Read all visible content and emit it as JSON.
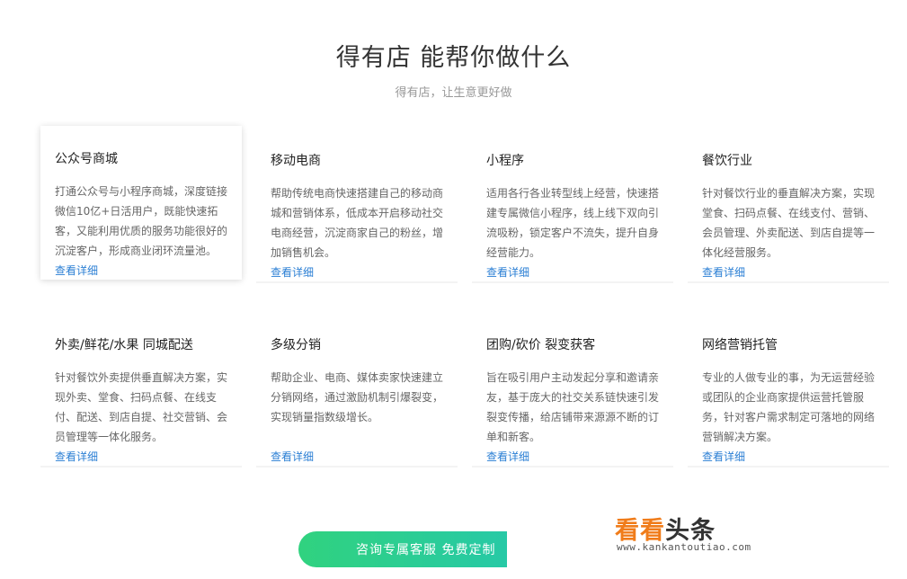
{
  "hero": {
    "title": "得有店 能帮你做什么",
    "subtitle": "得有店，让生意更好做"
  },
  "cards": [
    {
      "title": "公众号商城",
      "desc": "打通公众号与小程序商城，深度链接微信10亿+日活用户，既能快速拓客，又能利用优质的服务功能很好的沉淀客户，形成商业闭环流量池。",
      "link": "查看详细"
    },
    {
      "title": "移动电商",
      "desc": "帮助传统电商快速搭建自己的移动商城和营销体系，低成本开启移动社交电商经营，沉淀商家自己的粉丝，增加销售机会。",
      "link": "查看详细"
    },
    {
      "title": "小程序",
      "desc": "适用各行各业转型线上经营，快速搭建专属微信小程序，线上线下双向引流吸粉，锁定客户不流失，提升自身经营能力。",
      "link": "查看详细"
    },
    {
      "title": "餐饮行业",
      "desc": "针对餐饮行业的垂直解决方案，实现堂食、扫码点餐、在线支付、营销、会员管理、外卖配送、到店自提等一体化经营服务。",
      "link": "查看详细"
    },
    {
      "title": "外卖/鲜花/水果 同城配送",
      "desc": "针对餐饮外卖提供垂直解决方案，实现外卖、堂食、扫码点餐、在线支付、配送、到店自提、社交营销、会员管理等一体化服务。",
      "link": "查看详细"
    },
    {
      "title": "多级分销",
      "desc": "帮助企业、电商、媒体卖家快速建立分销网络，通过激励机制引爆裂变，实现销量指数级增长。",
      "link": "查看详细"
    },
    {
      "title": "团购/砍价 裂变获客",
      "desc": "旨在吸引用户主动发起分享和邀请亲友，基于庞大的社交关系链快速引发裂变传播，给店铺带来源源不断的订单和新客。",
      "link": "查看详细"
    },
    {
      "title": "网络营销托管",
      "desc": "专业的人做专业的事，为无运营经验或团队的企业商家提供运营托管服务，针对客户需求制定可落地的网络营销解决方案。",
      "link": "查看详细"
    }
  ],
  "cta": {
    "label": "咨询专属客服 免费定制"
  },
  "watermark": {
    "part1": "看看",
    "part2": "头条",
    "url": "www.kankantoutiao.com"
  },
  "colors": {
    "link": "#2b7fd4",
    "cta_start": "#30d27f",
    "cta_end": "#27c9a6",
    "watermark_accent": "#f07c1a"
  }
}
